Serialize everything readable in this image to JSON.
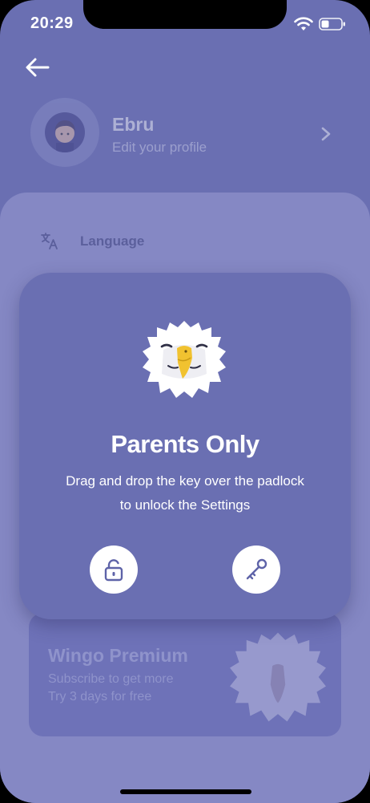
{
  "status_bar": {
    "time": "20:29"
  },
  "profile": {
    "name": "Ebru",
    "subtitle": "Edit your profile"
  },
  "settings": {
    "language_label": "Language"
  },
  "modal": {
    "title": "Parents Only",
    "description_line1": "Drag and drop the key over the padlock",
    "description_line2": "to unlock the Settings"
  },
  "premium": {
    "title": "Wingo Premium",
    "line1": "Subscribe to get more",
    "line2": "Try 3 days for free"
  },
  "colors": {
    "background": "#6a6fb2",
    "sheet": "#8588c4",
    "modal": "#6a6fb2",
    "accent_white": "#ffffff"
  },
  "icons": [
    "back-arrow-icon",
    "wifi-icon",
    "battery-icon",
    "chevron-right-icon",
    "translate-icon",
    "padlock-icon",
    "key-icon",
    "eagle-mascot"
  ]
}
